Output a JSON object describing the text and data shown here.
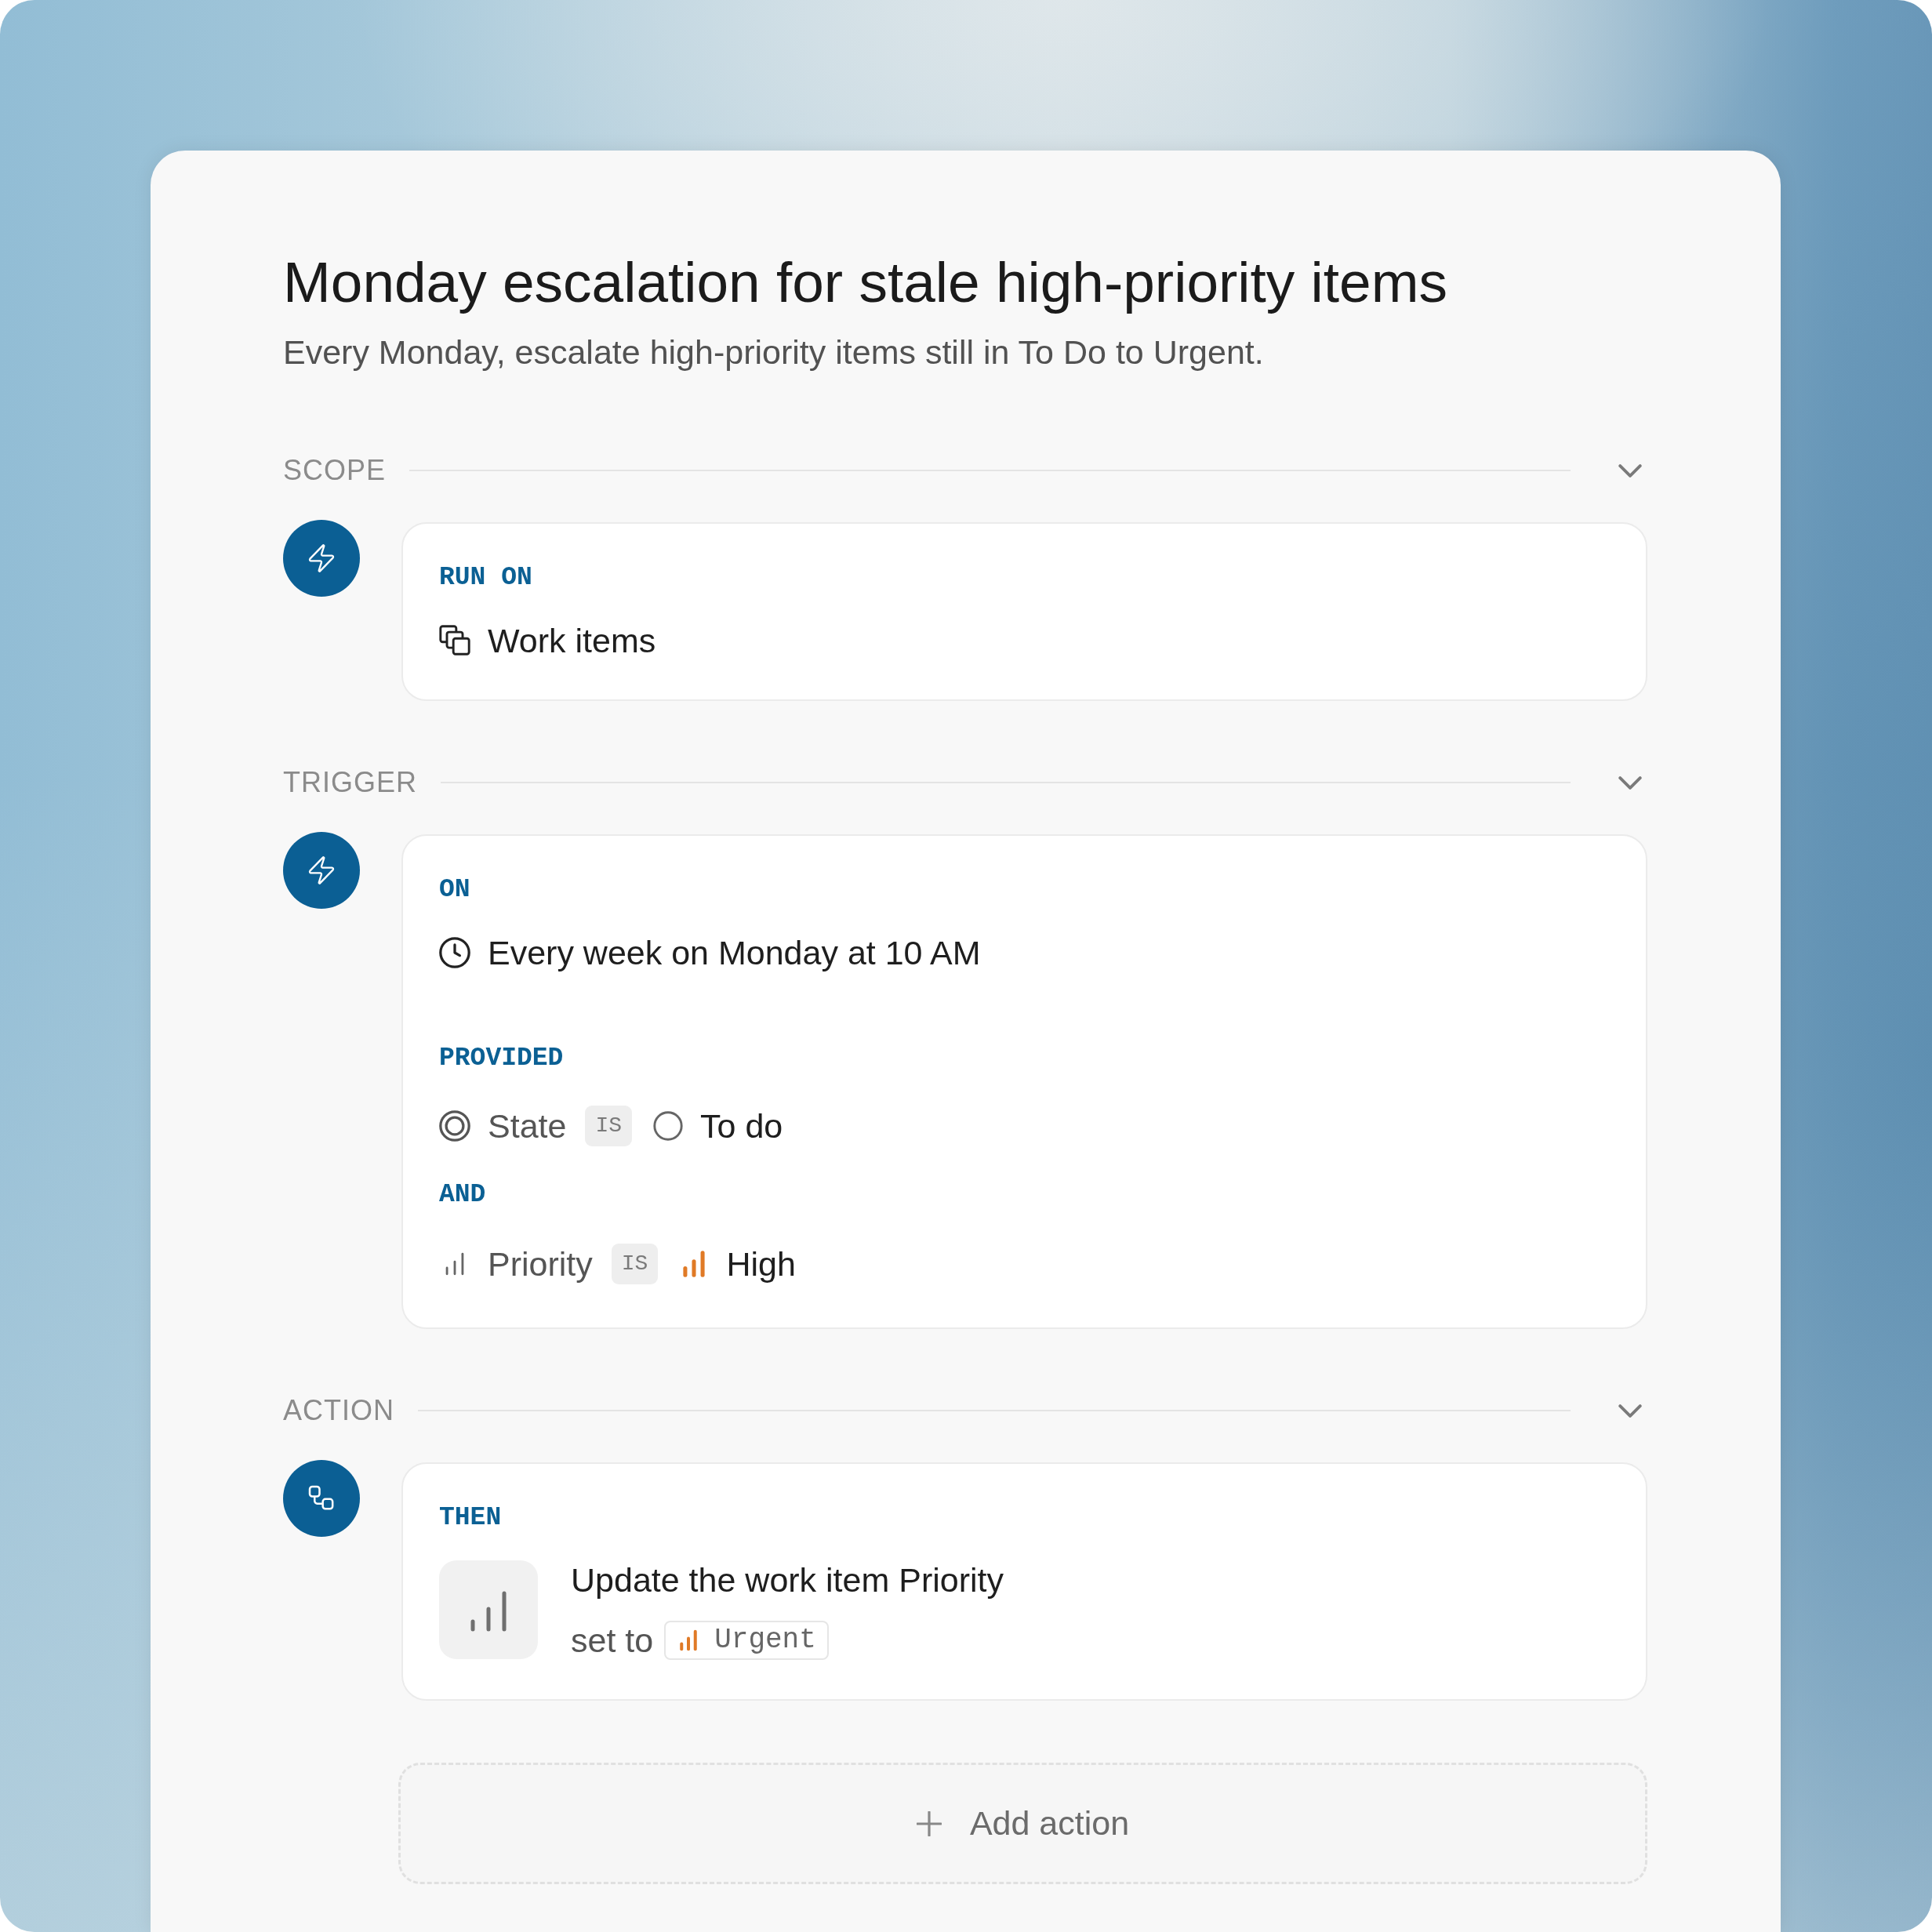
{
  "automation": {
    "title": "Monday escalation for stale high-priority items",
    "description": "Every Monday, escalate high-priority items still in To Do to Urgent."
  },
  "sections": [
    {
      "kind": "scope",
      "label": "SCOPE",
      "expanded": true,
      "blocks": [
        {
          "heading": "RUN ON",
          "rows": [
            {
              "kind": "scope",
              "text": "Work items"
            }
          ]
        }
      ]
    },
    {
      "kind": "trigger",
      "label": "TRIGGER",
      "expanded": true,
      "blocks": [
        {
          "heading": "ON",
          "rows": [
            {
              "kind": "schedule",
              "text": "Every week on Monday at 10 AM"
            }
          ]
        },
        {
          "heading": "PROVIDED",
          "rows": [
            {
              "kind": "state",
              "field": "State",
              "operator": "IS",
              "value": "To do"
            },
            {
              "kind": "connector",
              "text": "AND"
            },
            {
              "kind": "priority",
              "field": "Priority",
              "operator": "IS",
              "value": "High"
            }
          ]
        }
      ]
    },
    {
      "kind": "action",
      "label": "ACTION",
      "expanded": true,
      "blocks": [
        {
          "heading": "THEN",
          "rows": [
            {
              "kind": "update",
              "text": "Update the work item Priority",
              "label": "set to",
              "value": "Urgent"
            }
          ]
        }
      ]
    }
  ],
  "add_action": {
    "label": "Add action"
  }
}
